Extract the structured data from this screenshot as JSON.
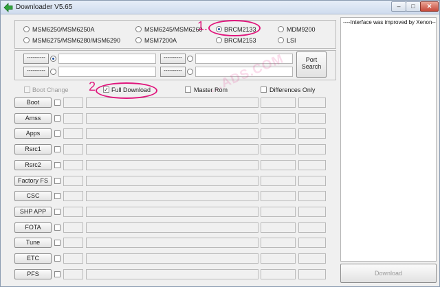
{
  "window": {
    "title": "Downloader V5.65",
    "controls": {
      "minimize": "–",
      "maximize": "□",
      "close": "✕"
    }
  },
  "chipset": {
    "options": [
      {
        "label": "MSM6250/MSM6250A",
        "selected": false
      },
      {
        "label": "MSM6245/MSM6260",
        "selected": false
      },
      {
        "label": "BRCM2133",
        "selected": true
      },
      {
        "label": "MDM9200",
        "selected": false
      },
      {
        "label": "MSM6275/MSM6280/MSM6290",
        "selected": false
      },
      {
        "label": "MSM7200A",
        "selected": false
      },
      {
        "label": "BRCM2153",
        "selected": false
      },
      {
        "label": "LSI",
        "selected": false
      }
    ]
  },
  "ports": {
    "slots": [
      {
        "button": "----------",
        "value": ""
      },
      {
        "button": "----------",
        "value": ""
      },
      {
        "button": "----------",
        "value": ""
      },
      {
        "button": "----------",
        "value": ""
      }
    ],
    "search_button": "Port Search"
  },
  "options": {
    "boot_change": "Boot Change",
    "full_download": "Full Download",
    "master_rom": "Master Rom",
    "differences_only": "Differences Only"
  },
  "files": {
    "rows": [
      {
        "label": "Boot"
      },
      {
        "label": "Amss"
      },
      {
        "label": "Apps"
      },
      {
        "label": "Rsrc1"
      },
      {
        "label": "Rsrc2"
      },
      {
        "label": "Factory FS"
      },
      {
        "label": "CSC"
      },
      {
        "label": "SHP APP"
      },
      {
        "label": "FOTA"
      },
      {
        "label": "Tune"
      },
      {
        "label": "ETC"
      },
      {
        "label": "PFS"
      }
    ]
  },
  "log": {
    "text": "----Interface was improved by Xenon----"
  },
  "download_button": "Download",
  "annotations": {
    "marker_1": "1.",
    "marker_2": "2"
  },
  "watermark": "...ADS.COM",
  "icons": {
    "app": "green-arrow-left-icon",
    "colors": {
      "accent": "#e0157c",
      "app_icon": "#2fa33b"
    }
  }
}
